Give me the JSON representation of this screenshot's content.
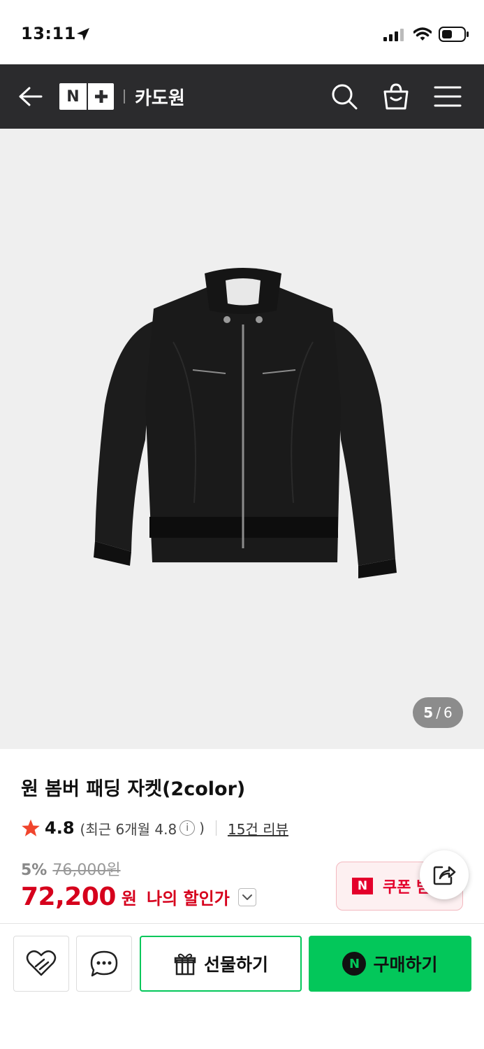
{
  "status_bar": {
    "time": "13:11",
    "icons": [
      "location-arrow-icon",
      "signal-icon",
      "wifi-icon",
      "battery-icon"
    ]
  },
  "header": {
    "logo_text": "N",
    "store_name": "카도원",
    "background": "#2b2b2d",
    "icons": [
      "back-arrow-icon",
      "search-icon",
      "cart-icon",
      "menu-icon"
    ]
  },
  "gallery": {
    "current_page": "5",
    "separator": "/",
    "total_pages": "6"
  },
  "product": {
    "title": "원 봄버 패딩 자켓(2color)",
    "rating": "4.8",
    "recent_rating_open": "(최근 6개월 4.8",
    "recent_rating_close": ")",
    "info_symbol": "i",
    "review_count": "15건 리뷰",
    "discount_rate": "5%",
    "original_price": "76,000원",
    "sale_price": "72,200",
    "currency": "원",
    "my_discount_label": "나의 할인가"
  },
  "coupon": {
    "badge": "N",
    "label": "쿠폰 받기"
  },
  "actions": {
    "gift_label": "선물하기",
    "buy_badge": "N",
    "buy_label": "구매하기"
  },
  "colors": {
    "price_red": "#d6001c",
    "naver_green": "#03c75a",
    "coupon_red": "#e4002b",
    "star": "#f0452d"
  }
}
